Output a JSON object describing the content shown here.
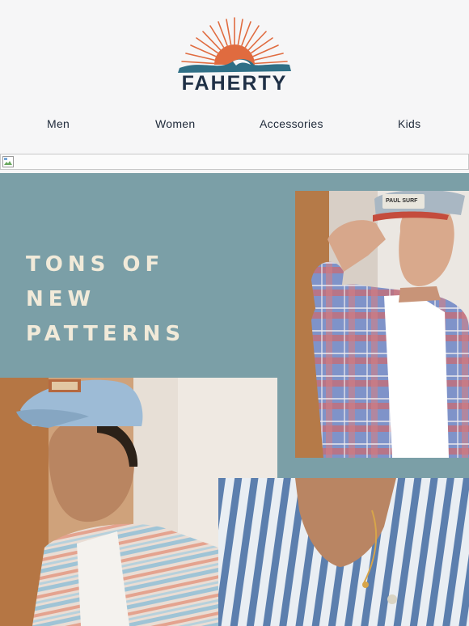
{
  "brand": {
    "name": "FAHERTY"
  },
  "nav": {
    "items": [
      {
        "label": "Men"
      },
      {
        "label": "Women"
      },
      {
        "label": "Accessories"
      },
      {
        "label": "Kids"
      }
    ]
  },
  "hero": {
    "headline": "TONS OF\nNEW\nPATTERNS",
    "cap_text": "PAUL SURF",
    "background_color": "#7b9fa7"
  },
  "colors": {
    "page_bg": "#f6f6f7",
    "headline": "#f1ead9",
    "logo_sun": "#e06b3f",
    "logo_wave": "#2f6f86",
    "logo_text": "#1f3046"
  }
}
